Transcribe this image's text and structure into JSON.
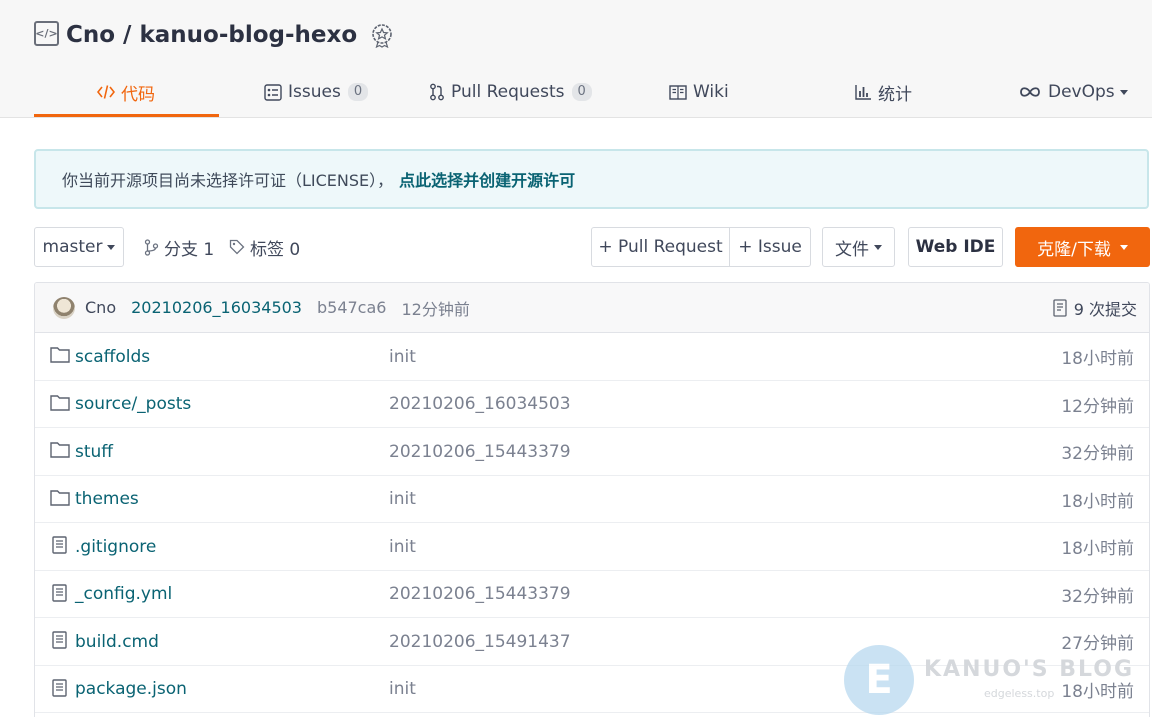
{
  "repo": {
    "title": "Cno / kanuo-blog-hexo"
  },
  "tabs": [
    {
      "label": "代码",
      "icon": "code-icon",
      "active": true
    },
    {
      "label": "Issues",
      "count": "0",
      "icon": "issues-icon"
    },
    {
      "label": "Pull Requests",
      "count": "0",
      "icon": "pull-request-icon"
    },
    {
      "label": "Wiki",
      "icon": "book-icon"
    },
    {
      "label": "统计",
      "icon": "bar-chart-icon"
    },
    {
      "label": "DevOps",
      "icon": "infinity-icon"
    }
  ],
  "notice": {
    "text": "你当前开源项目尚未选择许可证（LICENSE），",
    "link": "点此选择并创建开源许可"
  },
  "toolbar": {
    "branch": "master",
    "branches": "分支 1",
    "tags": "标签 0",
    "pull_request": "+ Pull Request",
    "issue": "+ Issue",
    "file": "文件",
    "web_ide": "Web IDE",
    "clone": "克隆/下载"
  },
  "commit": {
    "author": "Cno",
    "message": "20210206_16034503",
    "sha": "b547ca6",
    "time": "12分钟前",
    "count": "9 次提交"
  },
  "files": [
    {
      "name": "scaffolds",
      "type": "folder",
      "message": "init",
      "time": "18小时前"
    },
    {
      "name": "source/_posts",
      "type": "folder",
      "message": "20210206_16034503",
      "time": "12分钟前"
    },
    {
      "name": "stuff",
      "type": "folder",
      "message": "20210206_15443379",
      "time": "32分钟前"
    },
    {
      "name": "themes",
      "type": "folder",
      "message": "init",
      "time": "18小时前"
    },
    {
      "name": ".gitignore",
      "type": "file",
      "message": "init",
      "time": "18小时前"
    },
    {
      "name": "_config.yml",
      "type": "file",
      "message": "20210206_15443379",
      "time": "32分钟前"
    },
    {
      "name": "build.cmd",
      "type": "file",
      "message": "20210206_15491437",
      "time": "27分钟前"
    },
    {
      "name": "package.json",
      "type": "file",
      "message": "init",
      "time": "18小时前"
    }
  ],
  "watermark": {
    "letter": "E",
    "title": "KANUO'S BLOG",
    "site": "edgeless.top"
  },
  "colors": {
    "accent": "#f1660e",
    "link": "#0a6373",
    "notice_bg": "#eef8fa"
  }
}
